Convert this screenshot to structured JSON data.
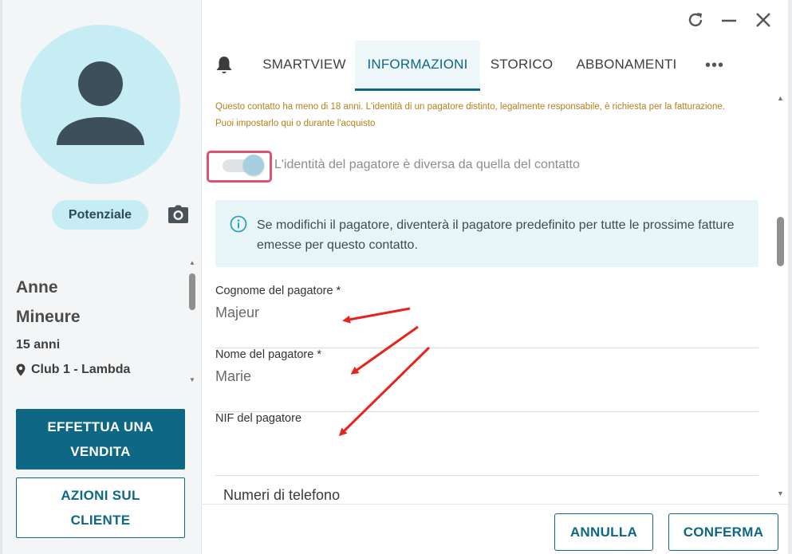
{
  "colors": {
    "primary": "#0d6785",
    "warning": "#b57f1a",
    "highlight": "#e0506f",
    "avatar_bg": "#c6edf3",
    "info_bg": "#e8f5f7"
  },
  "contact": {
    "status": "Potenziale",
    "first_name": "Anne",
    "last_name": "Mineure",
    "age": "15 anni",
    "club": "Club 1 - Lambda"
  },
  "left_actions": {
    "sell": [
      "EFFETTUA UNA",
      "VENDITA"
    ],
    "client_actions": [
      "AZIONI SUL",
      "CLIENTE"
    ]
  },
  "window_controls": [
    "refresh-icon",
    "minimize-icon",
    "close-icon"
  ],
  "tabs": [
    {
      "label": "SMARTVIEW",
      "active": false
    },
    {
      "label": "INFORMAZIONI",
      "active": true
    },
    {
      "label": "STORICO",
      "active": false
    },
    {
      "label": "ABBONAMENTI",
      "active": false
    }
  ],
  "tab_more": "•••",
  "warning": "Questo contatto ha meno di 18 anni. L'identità di un pagatore distinto, legalmente responsabile, è richiesta per la fatturazione. Puoi impostarlo qui o durante l'acquisto",
  "payer_toggle": {
    "label": "L'identità del pagatore è diversa da quella del contatto",
    "on": true
  },
  "info_banner": "Se modifichi il pagatore, diventerà il pagatore predefinito per tutte le prossime fatture emesse per questo contatto.",
  "fields": [
    {
      "label": "Cognome del pagatore *",
      "value": "Majeur"
    },
    {
      "label": "Nome del pagatore *",
      "value": "Marie"
    },
    {
      "label": "NIF del pagatore",
      "value": ""
    }
  ],
  "section_phone": "Numeri di telefono",
  "footer": {
    "cancel": "ANNULLA",
    "confirm": "CONFERMA"
  }
}
